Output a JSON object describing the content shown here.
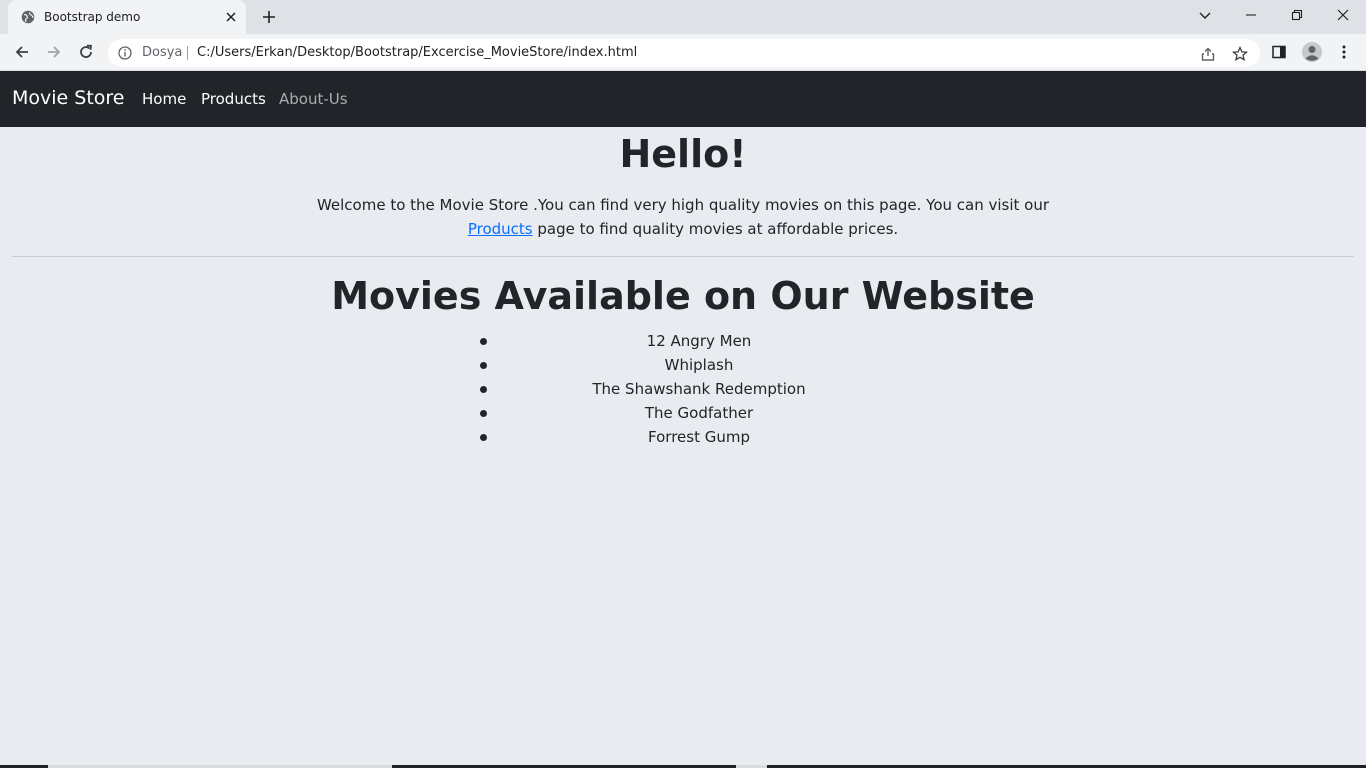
{
  "browser": {
    "tab_title": "Bootstrap demo",
    "scheme_label": "Dosya",
    "url": "C:/Users/Erkan/Desktop/Bootstrap/Excercise_MovieStore/index.html"
  },
  "navbar": {
    "brand": "Movie Store",
    "links": [
      {
        "label": "Home",
        "color": "#ffffff"
      },
      {
        "label": "Products",
        "color": "#ffffff"
      },
      {
        "label": "About-Us",
        "color": "#a9adb1"
      }
    ]
  },
  "hero": {
    "title": "Hello!",
    "text_before": "Welcome to the Movie Store .You can find very high quality movies on this page. You can visit our ",
    "link_text": "Products",
    "text_after": " page to find quality movies at affordable prices."
  },
  "movies": {
    "title": "Movies Available on Our Website",
    "items": [
      "12 Angry Men",
      "Whiplash",
      "The Shawshank Redemption",
      "The Godfather",
      "Forrest Gump"
    ]
  },
  "colors": {
    "navbar_bg": "#212529",
    "page_bg": "#e8ebef",
    "link": "#0d6efd"
  }
}
